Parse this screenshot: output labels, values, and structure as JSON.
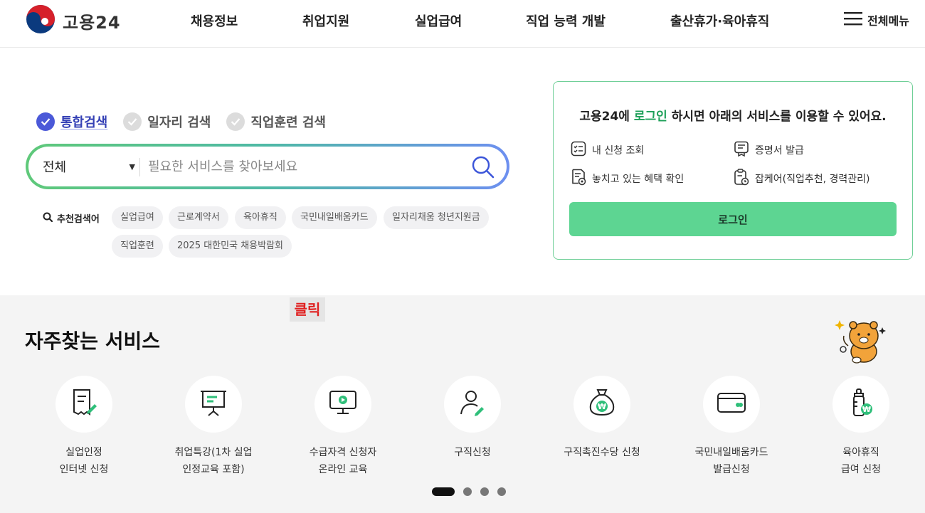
{
  "header": {
    "logo_text": "고용24",
    "nav": [
      "채용정보",
      "취업지원",
      "실업급여",
      "직업 능력 개발",
      "출산휴가·육아휴직"
    ],
    "all_menu_label": "전체메뉴"
  },
  "search": {
    "tabs": [
      {
        "label": "통합검색",
        "active": true
      },
      {
        "label": "일자리 검색",
        "active": false
      },
      {
        "label": "직업훈련 검색",
        "active": false
      }
    ],
    "category_value": "전체",
    "placeholder": "필요한 서비스를 찾아보세요",
    "recommend_label": "추천검색어",
    "keywords": [
      "실업급여",
      "근로계약서",
      "육아휴직",
      "국민내일배움카드",
      "일자리채움 청년지원금",
      "직업훈련",
      "2025 대한민국 채용박람회"
    ]
  },
  "login_panel": {
    "title_pre": "고용24에 ",
    "title_link": "로그인",
    "title_post": " 하시면 아래의 서비스를 이용할 수 있어요.",
    "services": [
      {
        "label": "내 신청 조회",
        "icon": "list-check-icon"
      },
      {
        "label": "증명서 발급",
        "icon": "certificate-icon"
      },
      {
        "label": "놓치고 있는 혜택 확인",
        "icon": "document-benefit-icon"
      },
      {
        "label": "잡케어(직업추천, 경력관리)",
        "icon": "clipboard-care-icon"
      }
    ],
    "button_label": "로그인"
  },
  "overlay": {
    "click_label": "클릭"
  },
  "frequent": {
    "title": "자주찾는 서비스",
    "items": [
      {
        "line1": "실업인정",
        "line2": "인터넷 신청",
        "icon": "document-pen-icon"
      },
      {
        "line1": "취업특강(1차 실업",
        "line2": "인정교육 포함)",
        "icon": "presentation-board-icon"
      },
      {
        "line1": "수급자격 신청자",
        "line2": "온라인 교육",
        "icon": "monitor-play-icon"
      },
      {
        "line1": "구직신청",
        "line2": "",
        "icon": "person-pen-icon"
      },
      {
        "line1": "구직촉진수당 신청",
        "line2": "",
        "icon": "money-bag-icon"
      },
      {
        "line1": "국민내일배움카드",
        "line2": "발급신청",
        "icon": "card-icon"
      },
      {
        "line1": "육아휴직",
        "line2": "급여 신청",
        "icon": "baby-bottle-icon"
      }
    ],
    "pagination": {
      "total": 4,
      "current": 1
    }
  },
  "colors": {
    "accent_green": "#5dd592",
    "brand_blue": "#4b59d8",
    "section_bg": "#f4f4f4",
    "click_red": "#e02020"
  }
}
